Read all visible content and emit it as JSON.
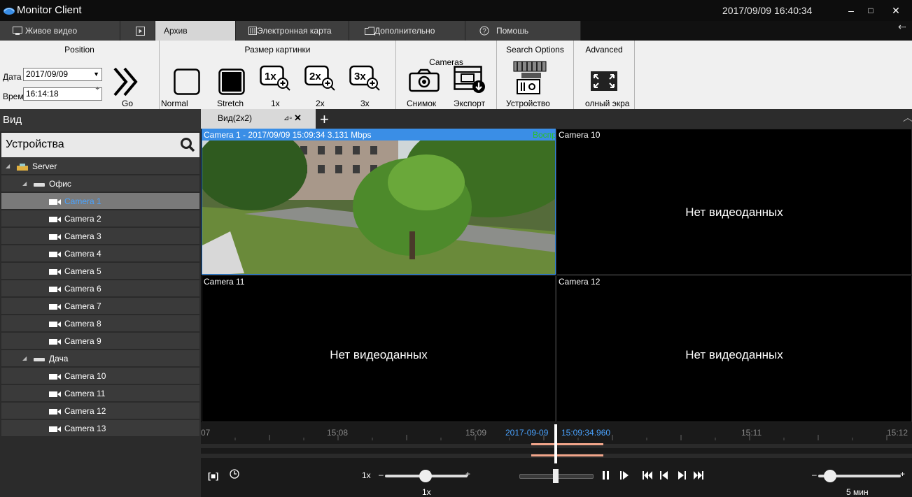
{
  "titlebar": {
    "title": "Monitor Client",
    "datetime": "2017/09/09 16:40:34",
    "minimize": "–",
    "maximize": "□",
    "close": "✕"
  },
  "tabs": [
    {
      "label": "Живое видео",
      "icon": "monitor-icon"
    },
    {
      "label": "Архив",
      "icon": "play-icon"
    },
    {
      "label": "Электронная карта",
      "icon": "map-icon"
    },
    {
      "label": "Дополнительно",
      "icon": "folder-icon"
    },
    {
      "label": "Помошь",
      "icon": "help-icon"
    }
  ],
  "ribbon": {
    "position": {
      "title": "Position",
      "date_label": "Дата",
      "date_value": "2017/09/09",
      "time_label": "Время",
      "time_value": "16:14:18",
      "go_label": "Go"
    },
    "picture_size": {
      "title": "Размер картинки",
      "buttons": [
        "Normal",
        "Stretch",
        "1x",
        "2x",
        "3x"
      ],
      "zoom_glyphs": [
        "1x",
        "2x",
        "3x"
      ]
    },
    "cameras": {
      "title": "Cameras",
      "buttons": [
        "Снимок",
        "Экспорт"
      ]
    },
    "search": {
      "title": "Search Options",
      "button": "Устройство"
    },
    "advanced": {
      "title": "Advanced",
      "button": "олный экра"
    }
  },
  "sidebar": {
    "header": "Вид",
    "search_label": "Устройства",
    "tree": [
      {
        "label": "Server",
        "level": 0,
        "type": "server",
        "expanded": true
      },
      {
        "label": "Офис",
        "level": 1,
        "type": "group",
        "expanded": true
      },
      {
        "label": "Camera 1",
        "level": 2,
        "type": "camera",
        "selected": true
      },
      {
        "label": "Camera 2",
        "level": 2,
        "type": "camera"
      },
      {
        "label": "Camera 3",
        "level": 2,
        "type": "camera"
      },
      {
        "label": "Camera 4",
        "level": 2,
        "type": "camera"
      },
      {
        "label": "Camera 5",
        "level": 2,
        "type": "camera"
      },
      {
        "label": "Camera 6",
        "level": 2,
        "type": "camera"
      },
      {
        "label": "Camera 7",
        "level": 2,
        "type": "camera"
      },
      {
        "label": "Camera 8",
        "level": 2,
        "type": "camera"
      },
      {
        "label": "Camera 9",
        "level": 2,
        "type": "camera"
      },
      {
        "label": "Дача",
        "level": 1,
        "type": "group",
        "expanded": true
      },
      {
        "label": "Camera 10",
        "level": 2,
        "type": "camera"
      },
      {
        "label": "Camera 11",
        "level": 2,
        "type": "camera"
      },
      {
        "label": "Camera 12",
        "level": 2,
        "type": "camera"
      },
      {
        "label": "Camera 13",
        "level": 2,
        "type": "camera"
      }
    ]
  },
  "view_tab": {
    "label": "Вид(2x2)",
    "pin_glyph": "⊿▫",
    "close_glyph": "✕",
    "add_glyph": "+",
    "collapse_glyph": "︿"
  },
  "cells": [
    {
      "title": "Camera 1 - 2017/09/09 15:09:34  3.131 Mbps",
      "status": "Воспр",
      "has_video": true
    },
    {
      "title": "Camera 10",
      "message": "Нет видеоданных"
    },
    {
      "title": "Camera 11",
      "message": "Нет видеоданных"
    },
    {
      "title": "Camera 12",
      "message": "Нет видеоданных"
    }
  ],
  "timeline": {
    "tick_labels": [
      "07",
      "15:08",
      "15:09",
      "15:11",
      "15:12"
    ],
    "current_date": "2017-09-09",
    "current_time": "15:09:34.960",
    "accent": "#4aa3ff",
    "record_color": "#f2a58a"
  },
  "controls": {
    "speed_label": "1x",
    "speed_value": "1x",
    "speed_minus": "–",
    "speed_plus": "+",
    "zoom_minus": "–",
    "zoom_plus": "+",
    "range_label": "5 мин"
  }
}
